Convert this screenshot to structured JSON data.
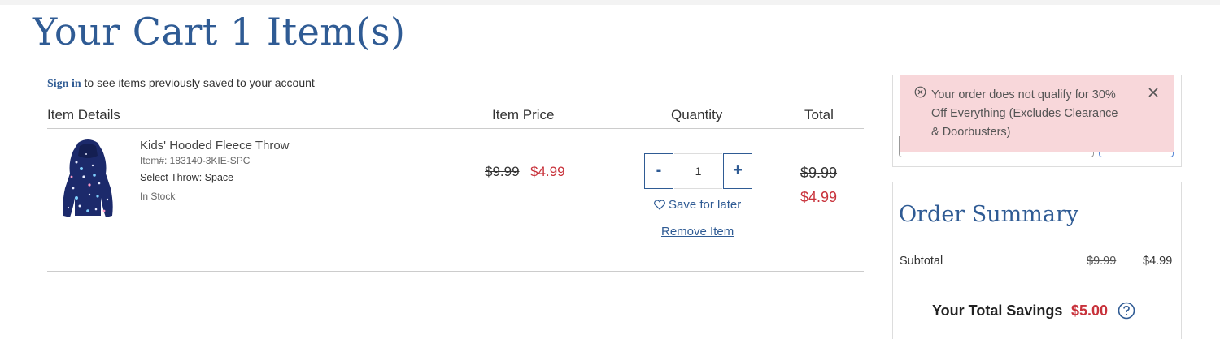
{
  "header": {
    "title": "Your Cart 1 Item(s)"
  },
  "signin": {
    "link": "Sign in",
    "text": " to see items previously saved to your account"
  },
  "table": {
    "columns": {
      "details": "Item Details",
      "price": "Item Price",
      "quantity": "Quantity",
      "total": "Total"
    }
  },
  "item": {
    "name": "Kids' Hooded Fleece Throw",
    "sku": "Item#: 183140-3KIE-SPC",
    "option": "Select Throw: Space",
    "stock": "In Stock",
    "price_original": "$9.99",
    "price_sale": "$4.99",
    "qty_minus": "-",
    "qty_value": "1",
    "qty_plus": "+",
    "save_for_later": "Save for later",
    "remove": "Remove Item",
    "total_original": "$9.99",
    "total_sale": "$4.99"
  },
  "alert": {
    "message": "Your order does not qualify for 30% Off Everything (Excludes Clearance & Doorbusters)",
    "icon": "circle-x-icon",
    "close_icon": "close-icon"
  },
  "summary": {
    "title": "Order Summary",
    "subtotal_label": "Subtotal",
    "subtotal_original": "$9.99",
    "subtotal_sale": "$4.99",
    "savings_label": "Your Total Savings",
    "savings_amount": "$5.00",
    "help_icon": "question-circle-icon"
  },
  "colors": {
    "brand_blue": "#2f5b94",
    "sale_red": "#c8323b",
    "alert_bg": "#f8d7da"
  }
}
